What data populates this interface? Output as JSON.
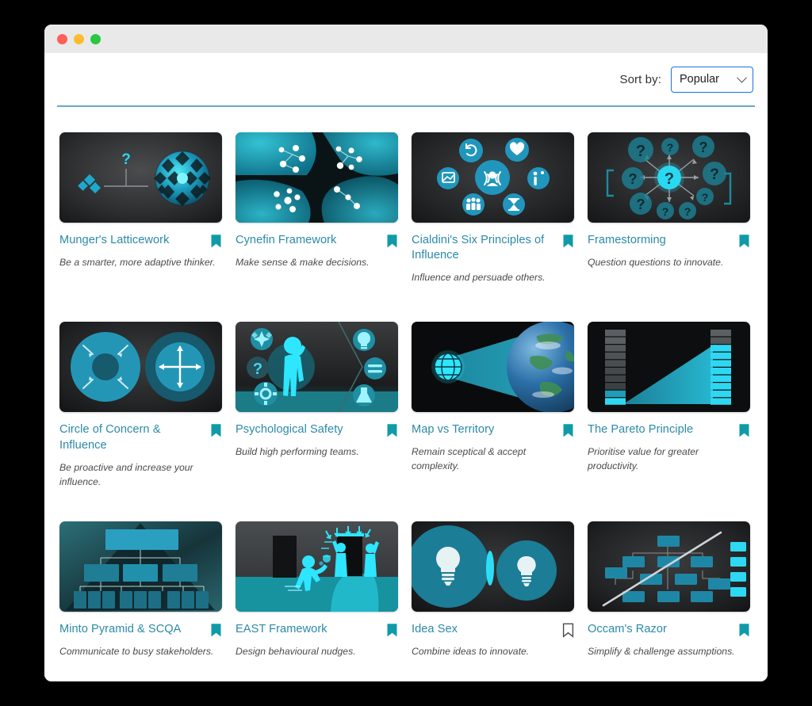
{
  "window": {
    "traffic_lights": [
      "close",
      "minimize",
      "maximize"
    ]
  },
  "toolbar": {
    "sort_label": "Sort by:",
    "sort_value": "Popular",
    "sort_options": [
      "Popular"
    ]
  },
  "colors": {
    "title_link": "#2b8aa8",
    "bookmark_active": "#0f9aa8",
    "bookmark_inactive": "#555555",
    "divider": "#6aa8bd",
    "select_border": "#1a73e8",
    "accent_cyan": "#2ee6ff",
    "accent_teal": "#1f9fbf"
  },
  "grid": {
    "rows": [
      {
        "cards": [
          {
            "id": "mungers-latticework",
            "title": "Munger's Latticework",
            "subtitle": "Be a smarter, more adaptive thinker.",
            "thumb": "latticework-sphere-thumbnail",
            "bookmarked": true
          },
          {
            "id": "cynefin-framework",
            "title": "Cynefin Framework",
            "subtitle": "Make sense & make decisions.",
            "thumb": "teal-blobs-nodes-thumbnail",
            "bookmarked": true
          },
          {
            "id": "cialdinis-six-principles-of-influence",
            "title": "Cialdini's Six Principles of Influence",
            "subtitle": "Influence and persuade others.",
            "thumb": "six-icon-circles-thumbnail",
            "bookmarked": true
          },
          {
            "id": "framestorming",
            "title": "Framestorming",
            "subtitle": "Question questions to innovate.",
            "thumb": "question-marks-radiating-thumbnail",
            "bookmarked": true
          }
        ]
      },
      {
        "cards": [
          {
            "id": "circle-of-concern-and-influence",
            "title": "Circle of Concern & Influence",
            "subtitle": "Be proactive and increase your influence.",
            "thumb": "two-circles-arrows-thumbnail",
            "bookmarked": true
          },
          {
            "id": "psychological-safety",
            "title": "Psychological Safety",
            "subtitle": "Build high performing teams.",
            "thumb": "thinking-person-icons-thumbnail",
            "bookmarked": true
          },
          {
            "id": "map-vs-territory",
            "title": "Map vs Territory",
            "subtitle": "Remain sceptical & accept complexity.",
            "thumb": "globe-icon-to-earth-thumbnail",
            "bookmarked": true
          },
          {
            "id": "the-pareto-principle",
            "title": "The Pareto Principle",
            "subtitle": "Prioritise value for greater productivity.",
            "thumb": "segmented-bars-wedge-thumbnail",
            "bookmarked": true
          }
        ]
      },
      {
        "cards": [
          {
            "id": "minto-pyramid-and-scqa",
            "title": "Minto Pyramid & SCQA",
            "subtitle": "Communicate to busy stakeholders.",
            "thumb": "pyramid-hierarchy-thumbnail",
            "bookmarked": true
          },
          {
            "id": "east-framework",
            "title": "EAST Framework",
            "subtitle": "Design behavioural nudges.",
            "thumb": "nudge-people-doorway-thumbnail",
            "bookmarked": true
          },
          {
            "id": "idea-sex",
            "title": "Idea Sex",
            "subtitle": "Combine ideas to innovate.",
            "thumb": "two-lightbulb-circles-thumbnail",
            "bookmarked": false
          },
          {
            "id": "occams-razor",
            "title": "Occam's Razor",
            "subtitle": "Simplify & challenge assumptions.",
            "thumb": "org-chart-slash-thumbnail",
            "bookmarked": true
          }
        ]
      }
    ]
  }
}
